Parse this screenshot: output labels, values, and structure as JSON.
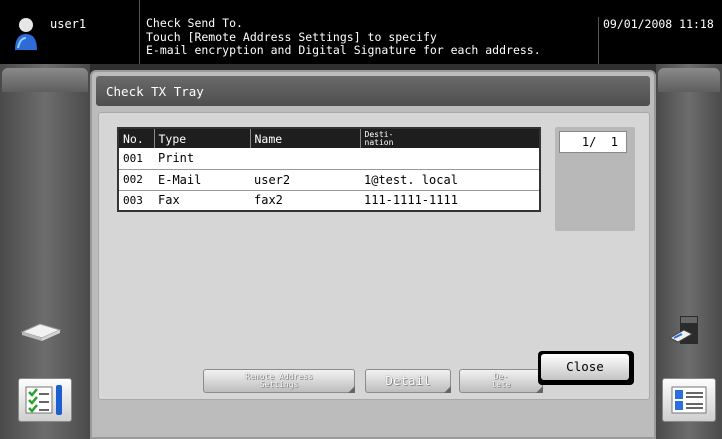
{
  "header": {
    "user": "user1",
    "message": "Check Send To.\nTouch [Remote Address Settings] to specify\nE-mail encryption and Digital Signature for each address.",
    "datetime": "09/01/2008  11:18"
  },
  "panel": {
    "title": "Check TX Tray"
  },
  "table": {
    "columns": [
      "No.",
      "Type",
      "Name",
      "Desti-\nnation"
    ],
    "rows": [
      {
        "no": "001",
        "type": "Print",
        "name": "",
        "destination": ""
      },
      {
        "no": "002",
        "type": "E-Mail",
        "name": "user2",
        "destination": "1@test. local"
      },
      {
        "no": "003",
        "type": "Fax",
        "name": "fax2",
        "destination": "111-1111-1111"
      }
    ]
  },
  "pager": {
    "text": "1/  1"
  },
  "buttons": {
    "remote": "Remote Address\nSettings",
    "detail": "Detail",
    "delete": "De-\nlete",
    "close": "Close"
  },
  "icons": {
    "user": "user-icon",
    "tray": "paper-tray-icon",
    "job_list": "job-list-icon",
    "scanner": "scanner-icon",
    "address_list": "address-list-icon"
  }
}
